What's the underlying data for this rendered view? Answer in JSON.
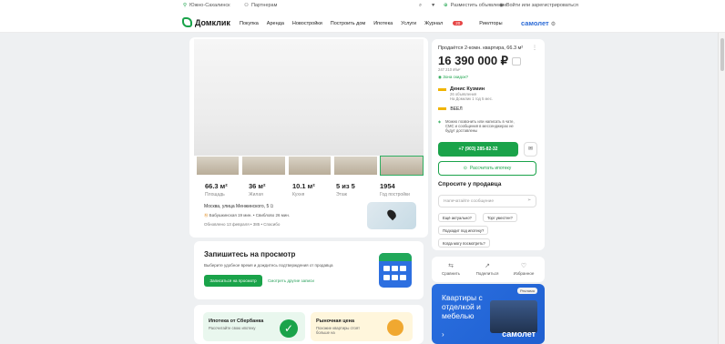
{
  "topbar": {
    "city": "Южно-Сахалинск",
    "partners": "Партнерам",
    "post_ad": "Разместить объявление",
    "login": "Войти или зарегистрироваться"
  },
  "nav": {
    "logo": "Домклик",
    "items": [
      "Покупка",
      "Аренда",
      "Новостройки",
      "Построить дом",
      "Ипотека",
      "Услуги",
      "Журнал",
      "Риелторы"
    ],
    "journal_badge": "20",
    "samolet": "самолет"
  },
  "listing": {
    "stats": [
      {
        "value": "66.3 м²",
        "label": "Площадь"
      },
      {
        "value": "36 м²",
        "label": "Жилая"
      },
      {
        "value": "10.1 м²",
        "label": "Кухня"
      },
      {
        "value": "5 из 5",
        "label": "Этаж"
      },
      {
        "value": "1954",
        "label": "Год постройки"
      }
    ],
    "address": "Москва, улица Менжинского, 5",
    "metro": "Бабушкинская 19 мин. • Свиблово 26 мин.",
    "updated": "Обновлено 13 февраля • 385 • Спасибо"
  },
  "schedule": {
    "title": "Запишитесь на просмотр",
    "subtitle": "Выберите удобное время и дождитесь подтверждения от продавца",
    "button": "Записаться на просмотр",
    "link": "Смотреть другие записи"
  },
  "promos": [
    {
      "title": "Ипотека от Сбербанка",
      "subtitle": "Рассчитайте свою ипотеку"
    },
    {
      "title": "Рыночная цена",
      "subtitle": "Похожие квартиры стоят больше на"
    }
  ],
  "side": {
    "title": "Продаётся 2-комн. квартира, 66.3 м²",
    "price": "16 390 000 ₽",
    "ppm": "247 210 ₽/м²",
    "zone": "Зона скидок?",
    "agent_name": "Денис Кузмин",
    "agent_ads": "26 объявления",
    "agent_since": "На Домклик 1 год 5 мес.",
    "company": "ВЕЕЛ",
    "note": "Можно позвонить или написать в чате, СМС и сообщения в мессенджерах не будут доставлены",
    "phone": "+7 (903) 285-82-32",
    "mortgage": "Рассчитать ипотеку",
    "ask_title": "Спросите у продавца",
    "ask_placeholder": "Напечатайте сообщение",
    "chips": [
      "Ещё актуально?",
      "Торг уместен?",
      "Подходит под ипотеку?",
      "Когда могу посмотреть?"
    ]
  },
  "actions": [
    {
      "label": "Сравнить",
      "icon": "compare-icon"
    },
    {
      "label": "Поделиться",
      "icon": "share-icon"
    },
    {
      "label": "Избранное",
      "icon": "heart-icon"
    }
  ],
  "ad": {
    "tag": "Реклама",
    "text": "Квартиры с отделкой и мебелью",
    "brand": "самолет"
  }
}
